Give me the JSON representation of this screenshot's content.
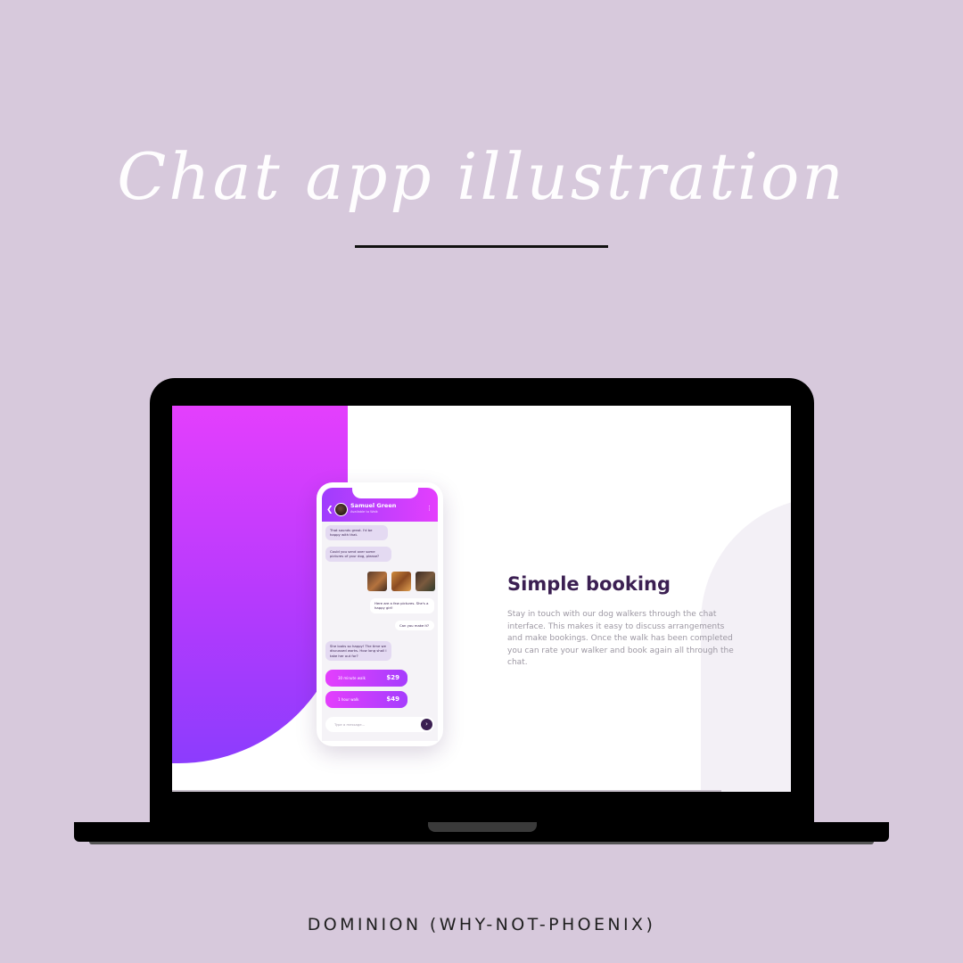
{
  "title": "Chat app illustration",
  "footer": "DOMINION (WHY-NOT-PHOENIX)",
  "phone": {
    "contact_name": "Samuel Green",
    "contact_status": "Available to Walk",
    "messages": [
      "That sounds great. I'd be happy with that.",
      "Could you send over some pictures of your dog, please?",
      "Here are a few pictures. She's a happy girl!",
      "Can you make it?",
      "She looks so happy! The time we discussed works. How long shall I take her out for?"
    ],
    "offers": [
      {
        "label": "30 minute walk",
        "price": "$29"
      },
      {
        "label": "1 hour walk",
        "price": "$49"
      }
    ],
    "input_placeholder": "Type a message...",
    "icons": {
      "back": "chevron-left-icon",
      "menu": "more-vertical-icon",
      "send": "send-arrow-icon"
    }
  },
  "content": {
    "heading": "Simple booking",
    "body": "Stay in touch with our dog walkers through the chat interface. This makes it easy to discuss arrangements and make bookings. Once the walk has been completed you can rate your walker and book again all through the chat."
  },
  "colors": {
    "background": "#d7c9dc",
    "accent_start": "#e43ffd",
    "accent_end": "#8c3cfd",
    "heading": "#3b1f52"
  }
}
